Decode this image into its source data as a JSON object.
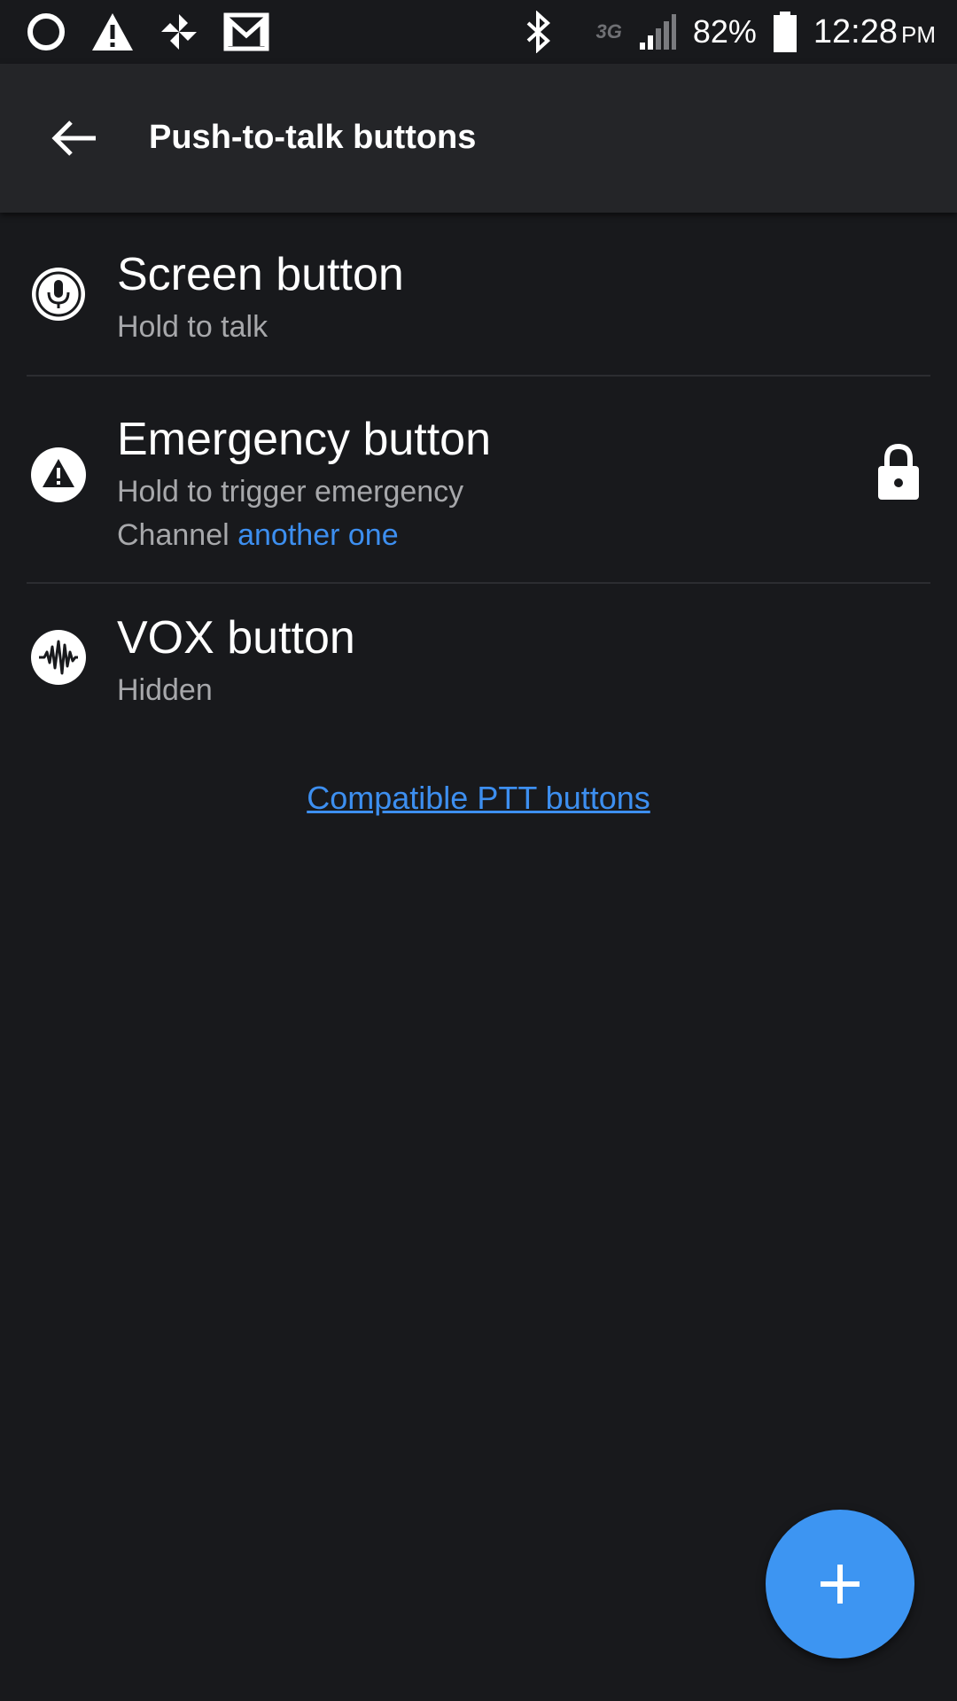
{
  "status_bar": {
    "battery_percent": "82%",
    "time": "12:28",
    "ampm": "PM",
    "network_label": "3G",
    "icons": [
      "circle-icon",
      "warning-icon",
      "pinwheel-icon",
      "gmail-icon",
      "bluetooth-icon",
      "signal-icon",
      "battery-icon"
    ]
  },
  "app_bar": {
    "title": "Push-to-talk buttons",
    "back_icon": "arrow-back-icon"
  },
  "items": [
    {
      "title": "Screen button",
      "subtitle": "Hold to talk",
      "icon": "microphone-icon"
    },
    {
      "title": "Emergency button",
      "subtitle": "Hold to trigger emergency",
      "channel_prefix": "Channel",
      "channel_name": "another one",
      "icon": "warning-icon",
      "trailing_icon": "lock-icon"
    },
    {
      "title": "VOX button",
      "subtitle": "Hidden",
      "icon": "waveform-icon"
    }
  ],
  "compatible_link": "Compatible PTT buttons",
  "fab": {
    "icon": "plus-icon"
  },
  "colors": {
    "background": "#18191c",
    "app_bar": "#242528",
    "accent": "#3d95f2",
    "link": "#3d8ff0",
    "secondary_text": "#a7a8ab"
  }
}
